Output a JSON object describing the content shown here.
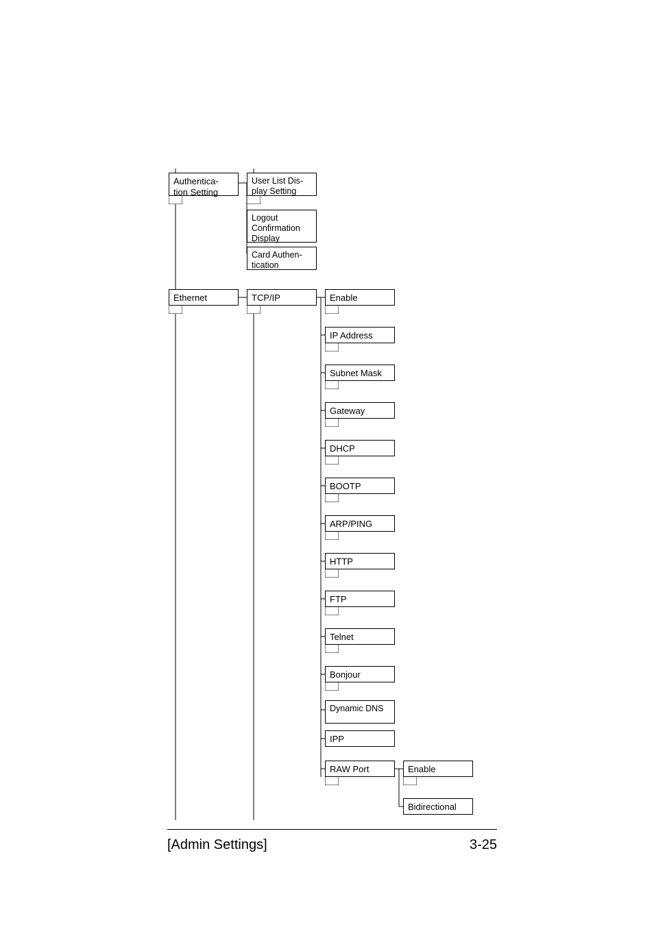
{
  "diagram": {
    "col0": {
      "auth": "Authentica-\ntion Setting",
      "ethernet": "Ethernet"
    },
    "col1": {
      "user_list": "User List Dis-\nplay Setting",
      "logout": "Logout Confirmation Display",
      "card_auth": "Card Authen-\ntication",
      "tcpip": "TCP/IP"
    },
    "col2": {
      "enable": "Enable",
      "ip_address": "IP Address",
      "subnet": "Subnet Mask",
      "gateway": "Gateway",
      "dhcp": "DHCP",
      "bootp": "BOOTP",
      "arpping": "ARP/PING",
      "http": "HTTP",
      "ftp": "FTP",
      "telnet": "Telnet",
      "bonjour": "Bonjour",
      "dyndns": "Dynamic DNS",
      "ipp": "IPP",
      "rawport": "RAW Port"
    },
    "col3": {
      "enable": "Enable",
      "bidir": "Bidirectional"
    }
  },
  "footer": {
    "left": "[Admin Settings]",
    "right": "3-25"
  }
}
